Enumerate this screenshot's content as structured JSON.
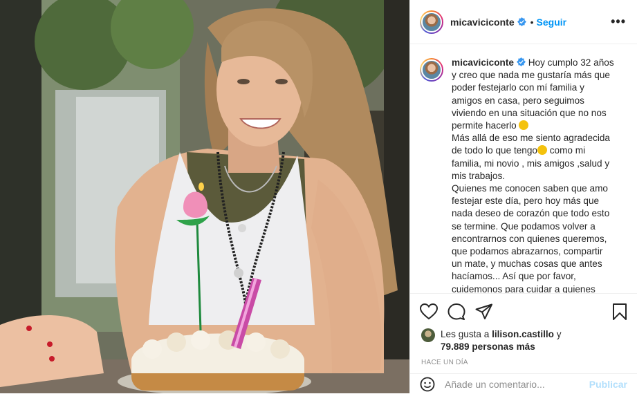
{
  "post": {
    "username": "micaviciconte",
    "dot": "•",
    "follow_label": "Seguir",
    "more_label": "•••",
    "caption_username": "micaviciconte",
    "caption_lines": [
      "Hoy cumplo 32 años",
      "y creo que nada me gustaría más que",
      "poder festejarlo con mí familia y",
      "amigos en casa, pero seguimos",
      "viviendo en una situación que no nos",
      "permite hacerlo",
      "Más allá de eso me siento agradecida",
      "de todo lo que tengo",
      "como mi",
      "familia, mi novio , mis amigos ,salud y",
      "mis trabajos.",
      "Quienes me conocen saben que amo",
      "festejar este día, pero hoy más que",
      "nada deseo de corazón que todo esto",
      "se termine. Que podamos volver a",
      "encontrarnos con quienes queremos,",
      "que podamos abrazarnos, compartir",
      "un mate, y muchas cosas que antes",
      "hacíamos... Así que por favor,",
      "cuidemonos para cuidar a quienes"
    ],
    "likes_prefix": "Les gusta a",
    "likes_user": "lilison.castillo",
    "likes_and": "y",
    "likes_count": "79.889 personas más",
    "timestamp": "HACE UN DÍA",
    "comment_placeholder": "Añade un comentario...",
    "publish_label": "Publicar"
  },
  "icons": {
    "verified": "verified-badge-icon",
    "like": "heart-icon",
    "comment": "comment-bubble-icon",
    "share": "paper-plane-icon",
    "save": "bookmark-icon",
    "emoji": "smiley-icon"
  },
  "colors": {
    "accent": "#0095f6",
    "verified": "#3897f0",
    "muted": "#8e8e8e",
    "publish_disabled": "#b2dffc"
  }
}
